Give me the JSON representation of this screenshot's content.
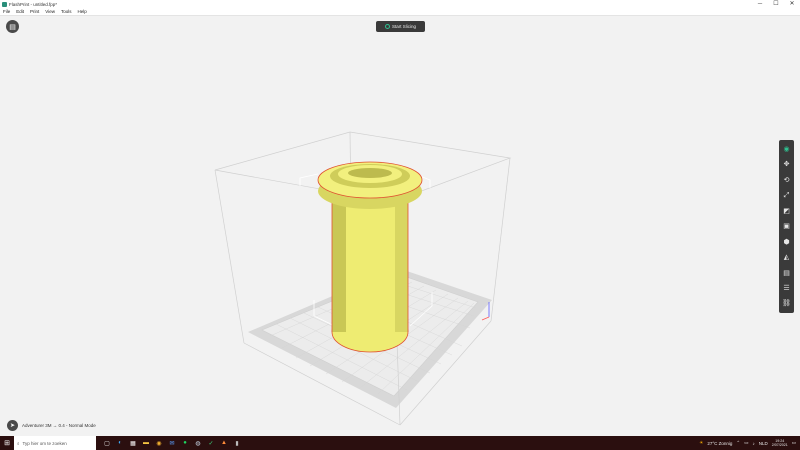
{
  "window": {
    "title": "FlashPrint - untitled.fpp*",
    "min": "─",
    "max": "☐",
    "close": "✕"
  },
  "menu": [
    "File",
    "Edit",
    "Print",
    "View",
    "Tools",
    "Help"
  ],
  "slice_button": {
    "label": "Start Slicing"
  },
  "status": {
    "printer": "Adventurer 3M → 0.4 - Normal Mode"
  },
  "toolbar": {
    "tools": [
      {
        "name": "view-icon",
        "glyph": "◉",
        "active": true
      },
      {
        "name": "move-icon",
        "glyph": "✥"
      },
      {
        "name": "rotate-icon",
        "glyph": "⟲"
      },
      {
        "name": "scale-icon",
        "glyph": "⤢"
      },
      {
        "name": "cut-icon",
        "glyph": "◩"
      },
      {
        "name": "support-icon",
        "glyph": "▣"
      },
      {
        "name": "layers-icon",
        "glyph": "⬢"
      },
      {
        "name": "measure-icon",
        "glyph": "◭"
      },
      {
        "name": "material-icon",
        "glyph": "▤"
      },
      {
        "name": "settings-icon",
        "glyph": "☰"
      },
      {
        "name": "link-icon",
        "glyph": "⛓"
      }
    ]
  },
  "taskbar": {
    "search_placeholder": "Typ hier om te zoeken",
    "weather": "27°C Zonnig",
    "lang": "NLD",
    "time": "19:24",
    "date": "2/07/2021"
  },
  "colors": {
    "model": "#f2f07e",
    "accent": "#2fbf8f",
    "taskbar": "#2b0f0f"
  }
}
